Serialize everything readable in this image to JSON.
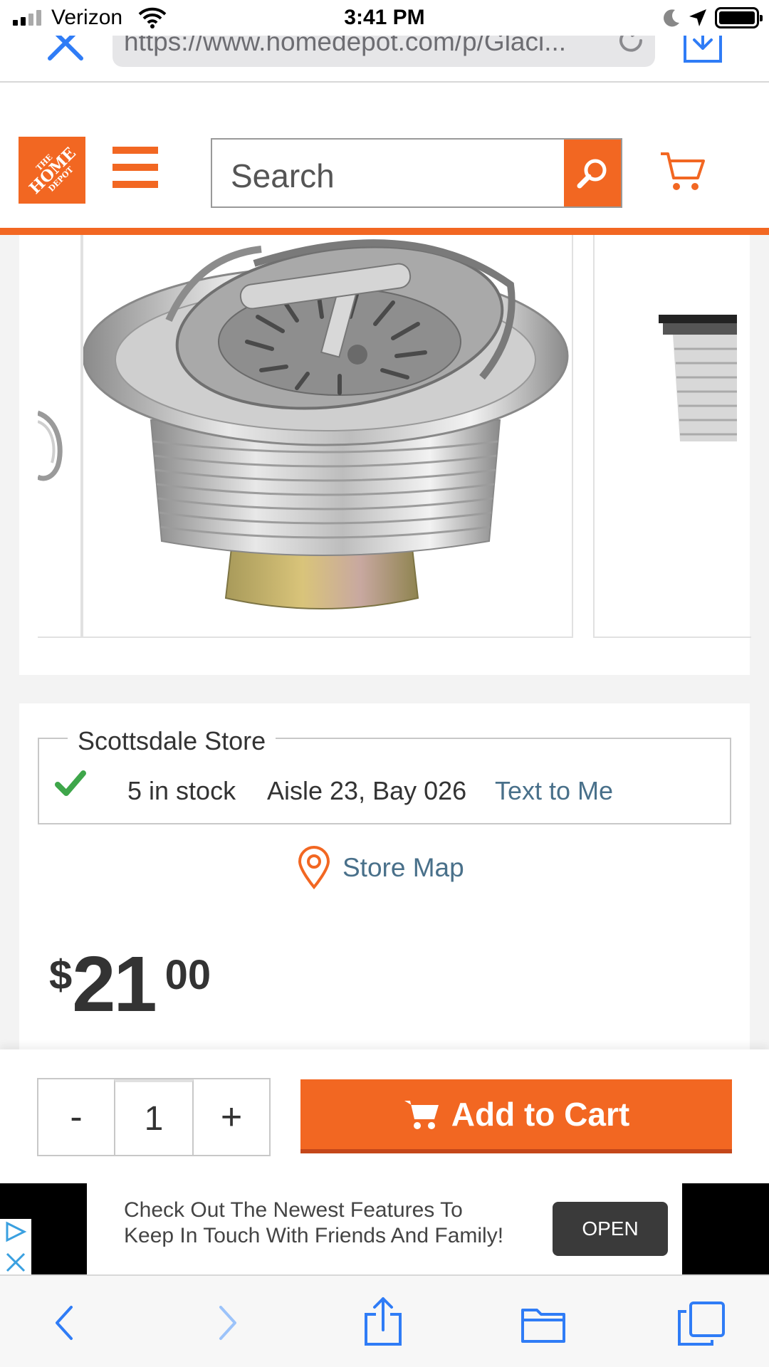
{
  "status_bar": {
    "carrier": "Verizon",
    "time": "3:41 PM"
  },
  "browser": {
    "url": "https://www.homedepot.com/p/Glaci..."
  },
  "header": {
    "logo_line1": "THE",
    "logo_line2": "HOME",
    "logo_line3": "DEPOT",
    "search_placeholder": "Search",
    "brand_color": "#f26722"
  },
  "store": {
    "name": "Scottsdale Store",
    "stock": "5 in stock",
    "location": "Aisle 23, Bay 026",
    "text_link": "Text to Me",
    "map_link": "Store Map"
  },
  "price": {
    "symbol": "$",
    "dollars": "21",
    "cents": "00"
  },
  "cart": {
    "minus": "-",
    "quantity": "1",
    "plus": "+",
    "add_label": "Add to Cart"
  },
  "ad": {
    "line1": "Check Out The Newest Features To",
    "line2": "Keep In Touch With Friends And Family!",
    "button": "OPEN"
  },
  "icons": {
    "close": "close-icon",
    "reload": "reload-icon",
    "download": "download-icon",
    "search": "search-icon",
    "cart": "cart-icon",
    "pin": "map-pin-icon",
    "check": "check-icon",
    "back": "back-arrow-icon",
    "forward": "forward-arrow-icon",
    "share": "share-icon",
    "bookmarks": "bookmarks-icon",
    "tabs": "tabs-icon"
  }
}
